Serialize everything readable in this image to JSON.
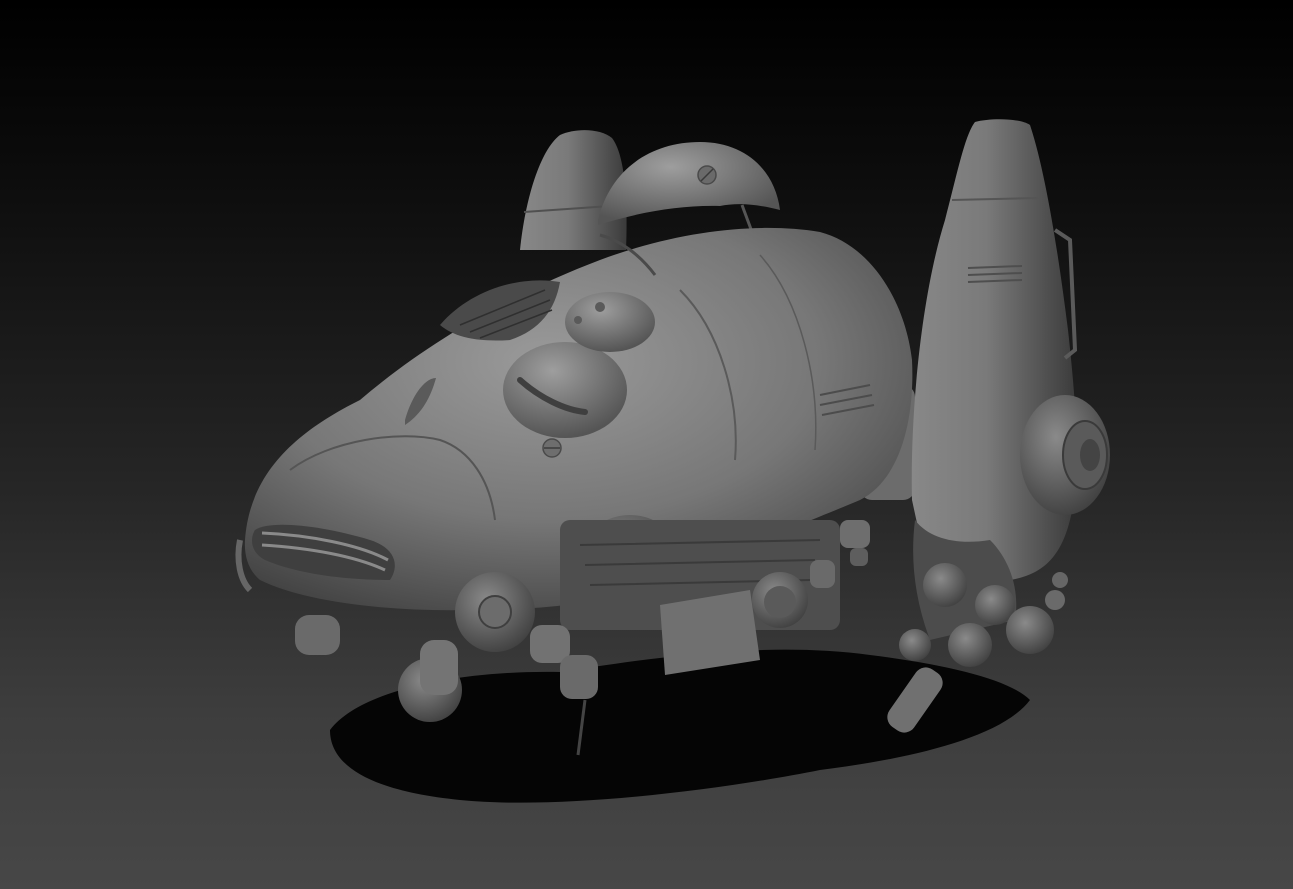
{
  "viewport": {
    "background_top": "#000000",
    "background_bottom": "#474747",
    "material_color": "#7c7c7c",
    "shadow_color": "#050505"
  },
  "subject": {
    "icon": "hover-vehicle-render",
    "description_visible_text": ""
  }
}
